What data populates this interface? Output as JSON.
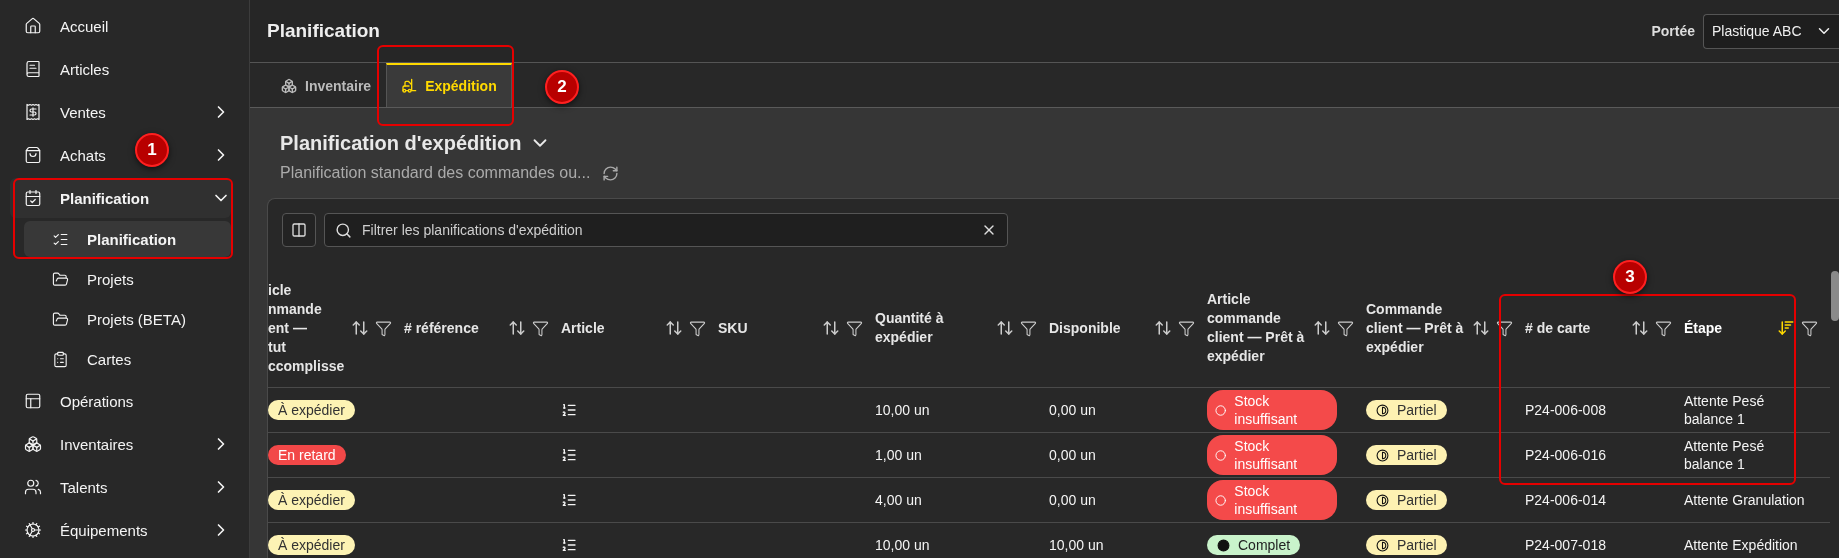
{
  "sidebar": {
    "items": [
      {
        "label": "Accueil",
        "kind": "link",
        "selected": false
      },
      {
        "label": "Articles",
        "kind": "link",
        "selected": false
      },
      {
        "label": "Ventes",
        "kind": "group",
        "expanded": false,
        "selected": false
      },
      {
        "label": "Achats",
        "kind": "group",
        "expanded": false,
        "selected": false
      },
      {
        "label": "Planification",
        "kind": "group",
        "expanded": true,
        "selected": true,
        "children": [
          {
            "label": "Planification",
            "selected": true
          },
          {
            "label": "Projets",
            "selected": false
          },
          {
            "label": "Projets (BETA)",
            "selected": false
          },
          {
            "label": "Cartes",
            "selected": false
          }
        ]
      },
      {
        "label": "Opérations",
        "kind": "link",
        "selected": false
      },
      {
        "label": "Inventaires",
        "kind": "group",
        "expanded": false,
        "selected": false
      },
      {
        "label": "Talents",
        "kind": "group",
        "expanded": false,
        "selected": false
      },
      {
        "label": "Équipements",
        "kind": "group",
        "expanded": false,
        "selected": false
      }
    ]
  },
  "header": {
    "title": "Planification",
    "scope_label": "Portée",
    "scope_value": "Plastique ABC"
  },
  "tabs": [
    {
      "label": "Inventaire",
      "selected": false
    },
    {
      "label": "Expédition",
      "selected": true
    }
  ],
  "section": {
    "title": "Planification d'expédition",
    "subtitle": "Planification standard des commandes ou..."
  },
  "filter": {
    "placeholder": "Filtrer les planifications d'expédition"
  },
  "table": {
    "columns": [
      {
        "label": "icle\nnmande\nent —\ntut\nccomplisse",
        "sorted": false
      },
      {
        "label": "# référence",
        "sorted": false
      },
      {
        "label": "Article",
        "sorted": false
      },
      {
        "label": "SKU",
        "sorted": false
      },
      {
        "label": "Quantité à expédier",
        "sorted": false
      },
      {
        "label": "Disponible",
        "sorted": false
      },
      {
        "label": "Article commande client — Prêt à expédier",
        "sorted": false
      },
      {
        "label": "Commande client — Prêt à expédier",
        "sorted": false
      },
      {
        "label": "# de carte",
        "sorted": false
      },
      {
        "label": "Étape",
        "sorted": true
      }
    ],
    "rows": [
      {
        "status": {
          "label": "À expédier",
          "kind": "to_ship"
        },
        "quantity": "10,00 un",
        "available": "0,00 un",
        "item_ready": {
          "label": "Stock insuffisant",
          "kind": "insufficient"
        },
        "order_ready": {
          "label": "Partiel",
          "kind": "partial"
        },
        "card": "P24-006-008",
        "stage": "Attente Pesé balance 1"
      },
      {
        "status": {
          "label": "En retard",
          "kind": "late"
        },
        "quantity": "1,00 un",
        "available": "0,00 un",
        "item_ready": {
          "label": "Stock insuffisant",
          "kind": "insufficient"
        },
        "order_ready": {
          "label": "Partiel",
          "kind": "partial"
        },
        "card": "P24-006-016",
        "stage": "Attente Pesé balance 1"
      },
      {
        "status": {
          "label": "À expédier",
          "kind": "to_ship"
        },
        "quantity": "4,00 un",
        "available": "0,00 un",
        "item_ready": {
          "label": "Stock insuffisant",
          "kind": "insufficient"
        },
        "order_ready": {
          "label": "Partiel",
          "kind": "partial"
        },
        "card": "P24-006-014",
        "stage": "Attente Granulation"
      },
      {
        "status": {
          "label": "À expédier",
          "kind": "to_ship"
        },
        "quantity": "10,00 un",
        "available": "10,00 un",
        "item_ready": {
          "label": "Complet",
          "kind": "complete"
        },
        "order_ready": {
          "label": "Partiel",
          "kind": "partial"
        },
        "card": "P24-007-018",
        "stage": "Attente Expédition"
      }
    ]
  },
  "annotations": [
    {
      "label": "1"
    },
    {
      "label": "2"
    },
    {
      "label": "3"
    }
  ]
}
